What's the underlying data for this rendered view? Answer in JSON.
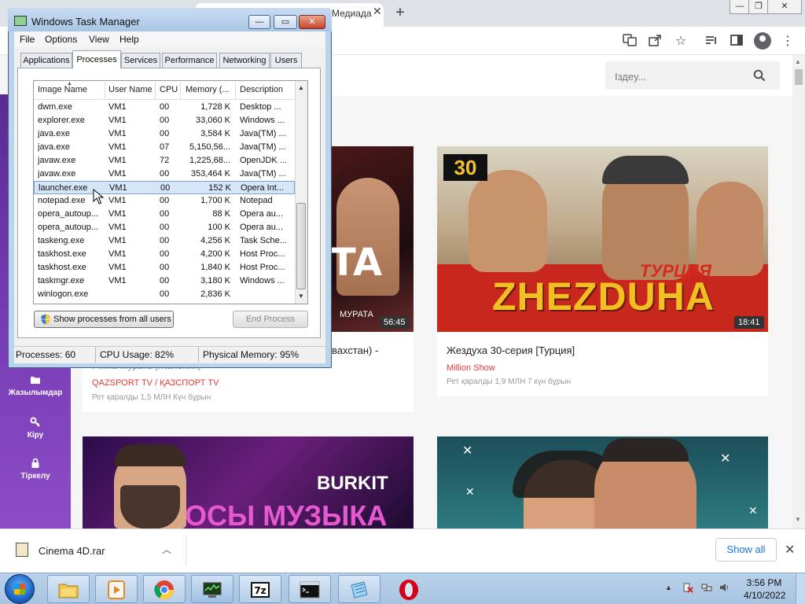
{
  "browser": {
    "tab_title": "Медиада",
    "new_tab": "+",
    "win_controls": {
      "minimize": "—",
      "maximize": "❐",
      "close": "✕"
    },
    "toolbar_icons": [
      "translate-icon",
      "share-icon",
      "star-icon",
      "reading-list-icon",
      "side-panel-icon",
      "profile-icon",
      "more-icon"
    ]
  },
  "site": {
    "search_placeholder": "Іздеу...",
    "nav": [
      {
        "label": "Жазылымдар",
        "icon": "folder-icon"
      },
      {
        "label": "Кіру",
        "icon": "key-icon"
      },
      {
        "label": "Тіркелу",
        "icon": "lock-icon"
      }
    ],
    "videos": [
      {
        "duration": "56:45",
        "title_line1": "вахстан) -",
        "title_line2": "Рикта Мурата (Жапония)",
        "channel": "QAZSPORT TV / ҚАЗСПОРТ TV",
        "meta": "Рет қаралды 1,5 МЛН   Күн бұрын",
        "thumb_text": "МУРАТА"
      },
      {
        "duration": "18:41",
        "title": "Жездуха 30-серия [Турция]",
        "channel": "Million Show",
        "meta": "Рет қаралды 1,9 МЛН   7 күн бұрын",
        "thumb_num": "30",
        "thumb_big": "ZHEZDUHA",
        "thumb_small": "ТУРЦИЯ"
      },
      {
        "thumb_a": "BURKIT",
        "thumb_b": "ОСЫ МУЗЫКА"
      },
      {}
    ]
  },
  "download_bar": {
    "file_name": "Cinema 4D.rar",
    "show_all": "Show all",
    "close": "✕"
  },
  "taskbar": {
    "time": "3:56 PM",
    "date": "4/10/2022"
  },
  "task_manager": {
    "title": "Windows Task Manager",
    "menus": [
      "File",
      "Options",
      "View",
      "Help"
    ],
    "tabs": [
      "Applications",
      "Processes",
      "Services",
      "Performance",
      "Networking",
      "Users"
    ],
    "active_tab": "Processes",
    "columns": [
      "Image Name",
      "User Name",
      "CPU",
      "Memory (...",
      "Description"
    ],
    "rows": [
      [
        "dwm.exe",
        "VM1",
        "00",
        "1,728 K",
        "Desktop ..."
      ],
      [
        "explorer.exe",
        "VM1",
        "00",
        "33,060 K",
        "Windows ..."
      ],
      [
        "java.exe",
        "VM1",
        "00",
        "3,584 K",
        "Java(TM) ..."
      ],
      [
        "java.exe",
        "VM1",
        "07",
        "5,150,56...",
        "Java(TM) ..."
      ],
      [
        "javaw.exe",
        "VM1",
        "72",
        "1,225,68...",
        "OpenJDK ..."
      ],
      [
        "javaw.exe",
        "VM1",
        "00",
        "353,464 K",
        "Java(TM) ..."
      ],
      [
        "launcher.exe",
        "VM1",
        "00",
        "152 K",
        "Opera Int..."
      ],
      [
        "notepad.exe",
        "VM1",
        "00",
        "1,700 K",
        "Notepad"
      ],
      [
        "opera_autoup...",
        "VM1",
        "00",
        "88 K",
        "Opera au..."
      ],
      [
        "opera_autoup...",
        "VM1",
        "00",
        "100 K",
        "Opera au..."
      ],
      [
        "taskeng.exe",
        "VM1",
        "00",
        "4,256 K",
        "Task Sche..."
      ],
      [
        "taskhost.exe",
        "VM1",
        "00",
        "4,200 K",
        "Host Proc..."
      ],
      [
        "taskhost.exe",
        "VM1",
        "00",
        "1,840 K",
        "Host Proc..."
      ],
      [
        "taskmgr.exe",
        "VM1",
        "00",
        "3,180 K",
        "Windows ..."
      ],
      [
        "winlogon.exe",
        "",
        "00",
        "2,836 K",
        ""
      ]
    ],
    "selected_row": 6,
    "show_all_button": "Show processes from all users",
    "end_process_button": "End Process",
    "status": {
      "processes": "Processes: 60",
      "cpu": "CPU Usage: 82%",
      "memory": "Physical Memory: 95%"
    }
  }
}
